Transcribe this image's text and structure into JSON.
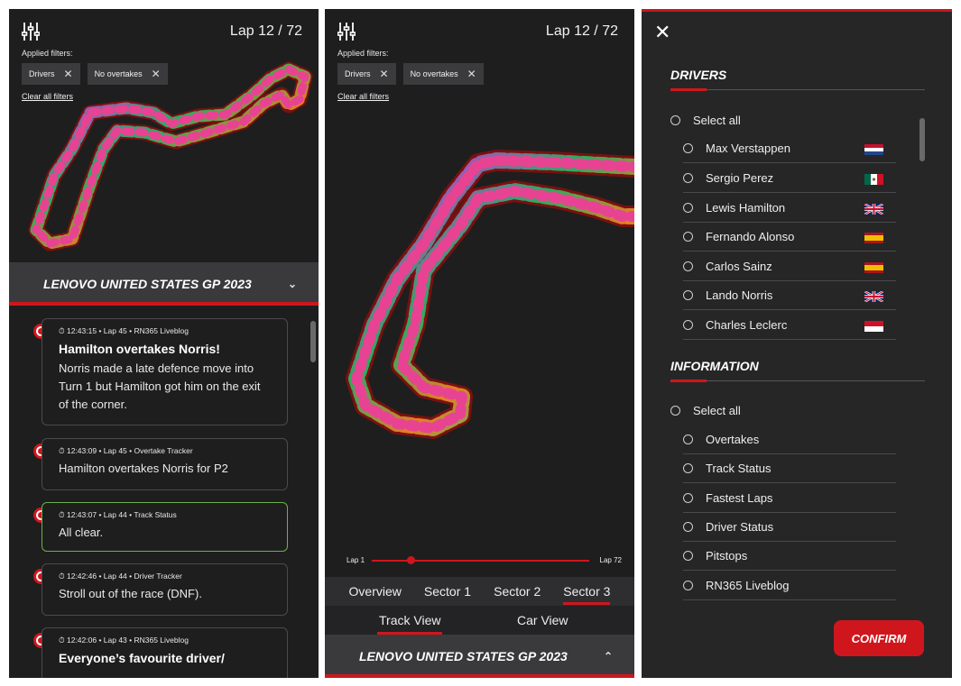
{
  "feed_panel": {
    "lap": "Lap 12 / 72",
    "applied_label": "Applied filters:",
    "chips": [
      {
        "label": "Drivers"
      },
      {
        "label": "No overtakes"
      }
    ],
    "clear_label": "Clear all filters",
    "gp_title": "LENOVO UNITED STATES GP 2023",
    "cards": [
      {
        "meta": "⏱ 12:43:15  •  Lap 45  •  RN365 Liveblog",
        "title": "Hamilton overtakes Norris!",
        "body": "Norris made a late defence move into Turn 1 but Hamilton got him on the exit of the corner."
      },
      {
        "meta": "⏱ 12:43:09  •  Lap 45  •  Overtake Tracker",
        "body": "Hamilton overtakes Norris for P2"
      },
      {
        "meta": "⏱ 12:43:07  •  Lap 44  •  Track Status",
        "body": "All clear."
      },
      {
        "meta": "⏱ 12:42:46  •  Lap 44  •  Driver Tracker",
        "body": "Stroll out of the race (DNF)."
      },
      {
        "meta": "⏱ 12:42:06  •  Lap 43  •  RN365 Liveblog",
        "title": "Everyone’s favourite driver/"
      }
    ]
  },
  "track_panel": {
    "lap": "Lap 12 / 72",
    "applied_label": "Applied filters:",
    "chips": [
      {
        "label": "Drivers"
      },
      {
        "label": "No overtakes"
      }
    ],
    "clear_label": "Clear all filters",
    "slider": {
      "start": "Lap 1",
      "end": "Lap 72",
      "position_lap": 12
    },
    "sectors": [
      "Overview",
      "Sector 1",
      "Sector 2",
      "Sector 3"
    ],
    "active_sector": "Sector 3",
    "views": [
      "Track View",
      "Car View"
    ],
    "active_view": "Track View",
    "gp_title": "LENOVO UNITED STATES GP 2023"
  },
  "filter_panel": {
    "drivers_title": "DRIVERS",
    "select_all": "Select all",
    "drivers": [
      "Max Verstappen",
      "Sergio Perez",
      "Lewis Hamilton",
      "Fernando Alonso",
      "Carlos Sainz",
      "Lando Norris",
      "Charles Leclerc"
    ],
    "information_title": "INFORMATION",
    "information": [
      "Overtakes",
      "Track Status",
      "Fastest Laps",
      "Driver Status",
      "Pitstops",
      "RN365 Liveblog"
    ],
    "confirm": "CONFIRM"
  },
  "colors": {
    "accent": "#d0161d",
    "panel": "#1e1e1e",
    "highlight": "#6ab04c"
  }
}
